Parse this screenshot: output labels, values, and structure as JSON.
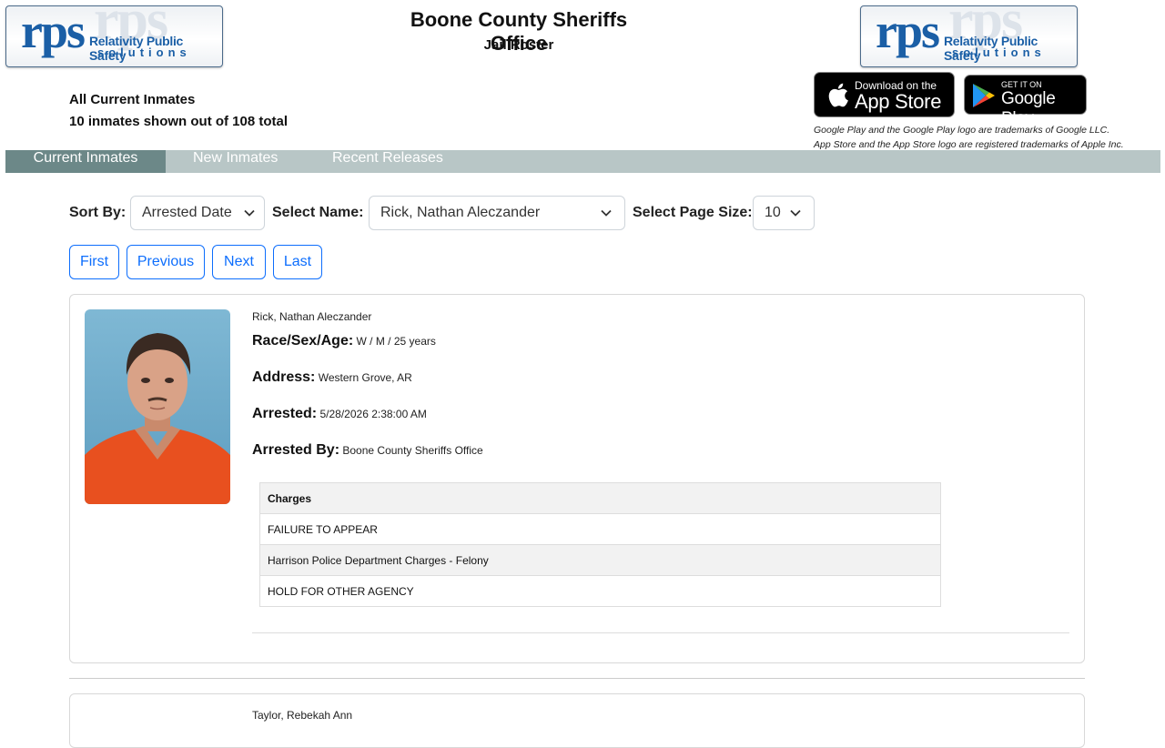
{
  "header": {
    "logo": {
      "abbr": "rps",
      "line1": "Relativity Public Safety",
      "line2": "solutions"
    },
    "title": "Boone County Sheriffs Office",
    "subtitle": "Jail Roster",
    "info_line1": "All Current Inmates",
    "info_line2": "10 inmates shown out of 108 total"
  },
  "stores": {
    "apple_small": "Download on the",
    "apple_big": "App Store",
    "google_small": "GET IT ON",
    "google_big": "Google Play",
    "trademark_google": "Google Play and the Google Play logo are trademarks of Google LLC.",
    "trademark_apple": "App Store and the App Store logo are registered trademarks of Apple Inc."
  },
  "tabs": [
    {
      "label": "Current Inmates",
      "active": true
    },
    {
      "label": "New Inmates",
      "active": false
    },
    {
      "label": "Recent Releases",
      "active": false
    }
  ],
  "controls": {
    "sort_label": "Sort By:",
    "sort_value": "Arrested Date",
    "name_label": "Select Name:",
    "name_value": "Rick, Nathan Aleczander",
    "pagesize_label": "Select Page Size:",
    "pagesize_value": "10"
  },
  "pagination": [
    "First",
    "Previous",
    "Next",
    "Last"
  ],
  "inmates": [
    {
      "name": "Rick, Nathan Aleczander",
      "race_sex_age_label": "Race/Sex/Age:",
      "race_sex_age": "W / M / 25 years",
      "address_label": "Address:",
      "address": "Western Grove, AR",
      "arrested_label": "Arrested:",
      "arrested": "5/28/2026 2:38:00 AM",
      "arrested_by_label": "Arrested By:",
      "arrested_by": "Boone County Sheriffs Office",
      "charges_header": "Charges",
      "charges": [
        "FAILURE TO APPEAR",
        "Harrison Police Department Charges - Felony",
        "HOLD FOR OTHER AGENCY"
      ]
    },
    {
      "name": "Taylor, Rebekah Ann"
    }
  ],
  "colors": {
    "tab_bar": "#b8c6c6",
    "tab_active": "#6c8888",
    "button_blue": "#0d6efd",
    "logo_blue": "#1b5fa6"
  }
}
